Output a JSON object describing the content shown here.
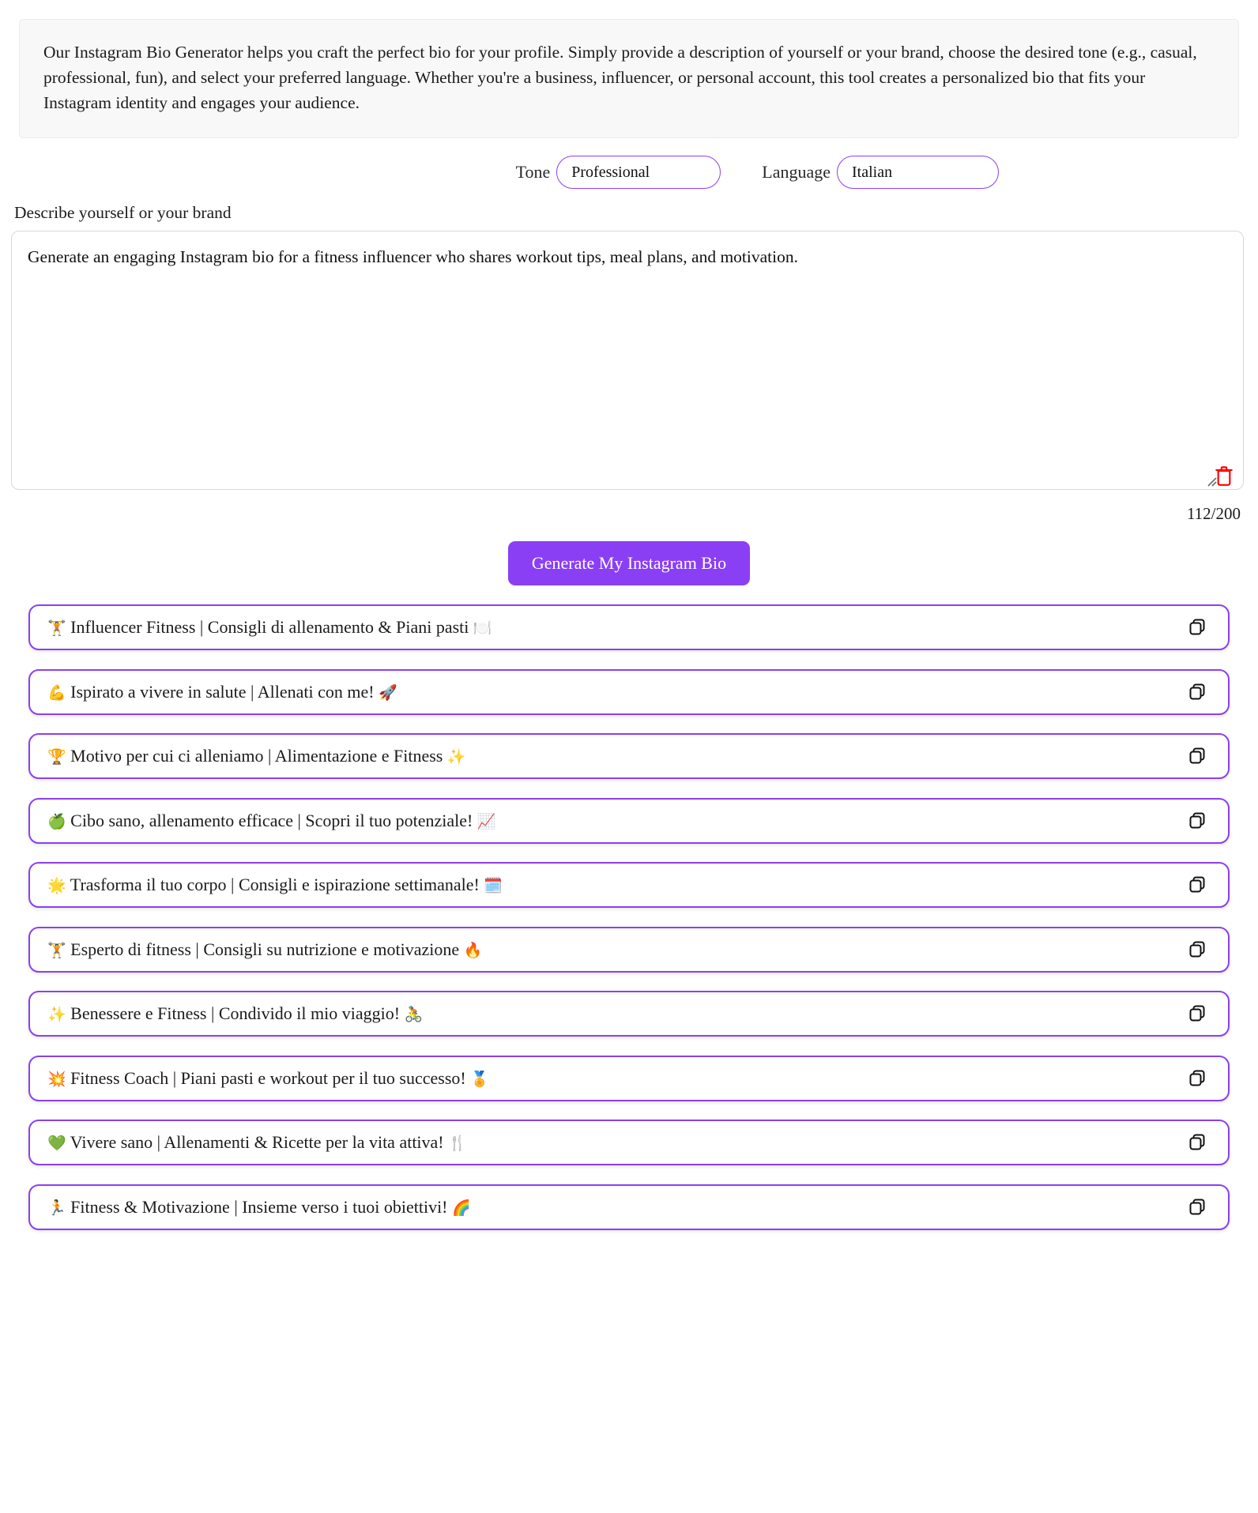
{
  "intro": {
    "text": "Our Instagram Bio Generator helps you craft the perfect bio for your profile. Simply provide a description of yourself or your brand, choose the desired tone (e.g., casual, professional, fun), and select your preferred language. Whether you're a business, influencer, or personal account, this tool creates a personalized bio that fits your Instagram identity and engages your audience."
  },
  "controls": {
    "tone": {
      "label": "Tone",
      "value": "Professional"
    },
    "language": {
      "label": "Language",
      "value": "Italian"
    }
  },
  "prompt": {
    "label": "Describe yourself or your brand",
    "value": "Generate an engaging Instagram bio for a fitness influencer who shares workout tips, meal plans, and motivation.",
    "placeholder": "Describe yourself or your brand",
    "counter": "112/200",
    "clear_icon": "trash-icon",
    "resize_icon": "resize-grip-icon"
  },
  "generate_button": {
    "label": "Generate My Instagram Bio"
  },
  "results": {
    "copy_icon": "copy-icon",
    "items": [
      {
        "text": "🏋️ Influencer Fitness | Consigli di allenamento & Piani pasti 🍽️"
      },
      {
        "text": "💪 Ispirato a vivere in salute | Allenati con me! 🚀"
      },
      {
        "text": "🏆 Motivo per cui ci alleniamo | Alimentazione e Fitness ✨"
      },
      {
        "text": "🍏 Cibo sano, allenamento efficace | Scopri il tuo potenziale! 📈"
      },
      {
        "text": "🌟 Trasforma il tuo corpo | Consigli e ispirazione settimanale! 🗓️"
      },
      {
        "text": "🏋️ Esperto di fitness | Consigli su nutrizione e motivazione 🔥"
      },
      {
        "text": "✨ Benessere e Fitness | Condivido il mio viaggio! 🚴"
      },
      {
        "text": "💥 Fitness Coach | Piani pasti e workout per il tuo successo! 🏅"
      },
      {
        "text": "💚 Vivere sano | Allenamenti & Ricette per la vita attiva! 🍴"
      },
      {
        "text": "🏃 Fitness & Motivazione | Insieme verso i tuoi obiettivi! 🌈"
      }
    ]
  },
  "colors": {
    "accent": "#8b3ff5",
    "danger": "#ff0000",
    "panel_bg": "#f8f8f8"
  }
}
